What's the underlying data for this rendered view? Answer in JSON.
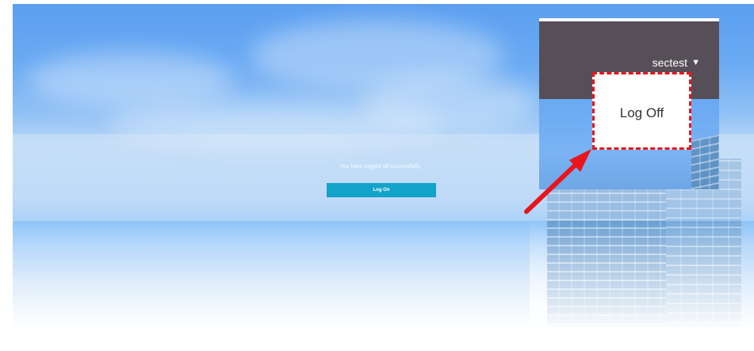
{
  "logon_page": {
    "message": "You have logged off successfully.",
    "logon_button_label": "Log On"
  },
  "zoom_inset": {
    "username": "sectest",
    "dropdown_icon": "caret-down-icon",
    "menu_item_label": "Log Off"
  },
  "annotation": {
    "arrow_icon": "red-arrow-icon",
    "highlight_color": "#e8151b"
  },
  "colors": {
    "logon_button": "#12a3c8",
    "header_background": "#564f58",
    "sky_top": "#5b9ff0"
  }
}
